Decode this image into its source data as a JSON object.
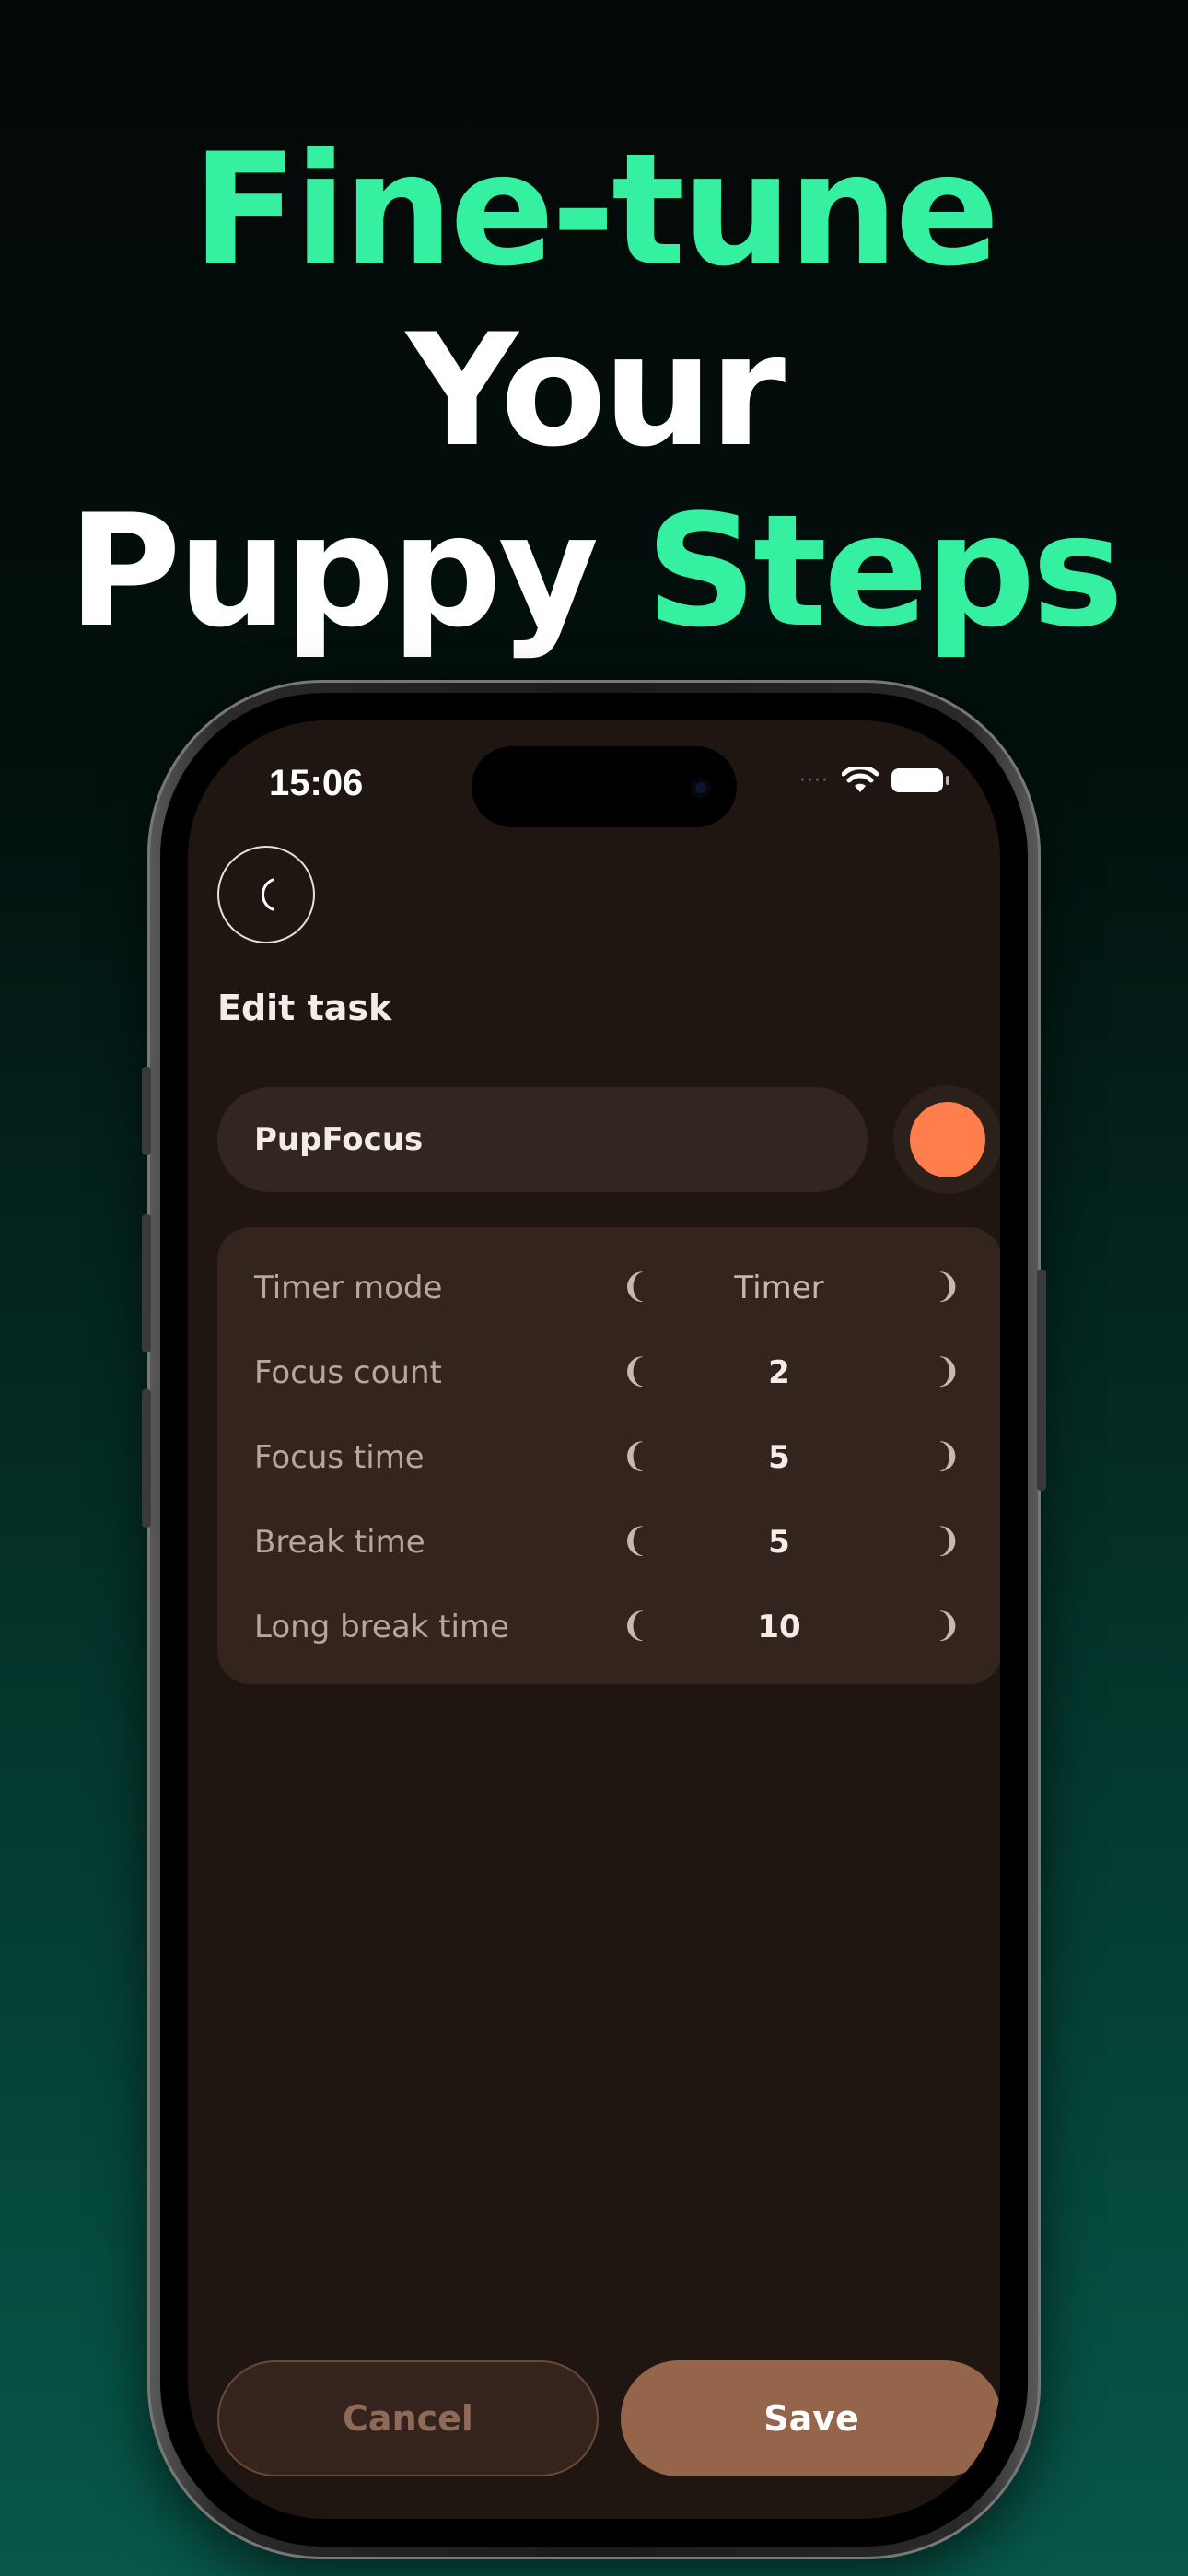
{
  "headline": {
    "line1_accent": "Fine-tune",
    "line1_white": "Your",
    "line2_white": "Puppy",
    "line2_accent": "Steps"
  },
  "status_bar": {
    "time": "15:06",
    "signal": "····"
  },
  "icons": {
    "back": "chevron-left-icon",
    "wifi": "wifi-icon",
    "battery": "battery-icon"
  },
  "page": {
    "title": "Edit task",
    "task_name": "PupFocus",
    "task_color": "#ff7e4b"
  },
  "settings": [
    {
      "label": "Timer mode",
      "value": "Timer"
    },
    {
      "label": "Focus count",
      "value": "2"
    },
    {
      "label": "Focus time",
      "value": "5"
    },
    {
      "label": "Break time",
      "value": "5"
    },
    {
      "label": "Long break time",
      "value": "10"
    }
  ],
  "arrows": {
    "left": "❨",
    "right": "❩"
  },
  "actions": {
    "cancel": "Cancel",
    "save": "Save"
  },
  "colors": {
    "accent": "#34f0a0",
    "screen_bg": "#1f1612",
    "card_bg": "#33241e",
    "save_button": "#94644b"
  }
}
